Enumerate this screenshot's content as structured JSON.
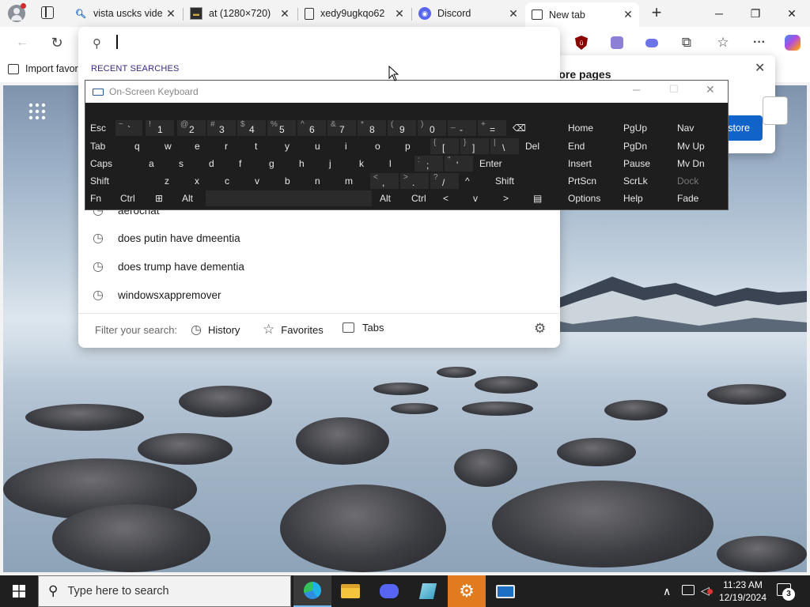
{
  "tabs": [
    {
      "label": "vista uscks vide",
      "icon": "search-favicon"
    },
    {
      "label": "at (1280×720)",
      "icon": "image-favicon"
    },
    {
      "label": "xedy9ugkqo62",
      "icon": "document-favicon"
    },
    {
      "label": "Discord",
      "icon": "discord-favicon"
    },
    {
      "label": "New tab",
      "icon": "newtab-favicon",
      "active": true
    }
  ],
  "toolbar": {
    "address_value": "",
    "extensions": [
      "ublock-icon",
      "extension-icon",
      "discord-extension-icon",
      "puzzle-icon",
      "favorites-icon",
      "more-icon",
      "copilot-icon"
    ]
  },
  "favbar": {
    "import_label": "Import favor"
  },
  "search": {
    "recent_header": "RECENT SEARCHES",
    "items": [
      "aerochat",
      "does putin have dmeentia",
      "does trump have dementia",
      "windowsxappremover"
    ],
    "filter_label": "Filter your search:",
    "filters": [
      "History",
      "Favorites",
      "Tabs"
    ]
  },
  "restore": {
    "title": "Restore pages",
    "button": "store"
  },
  "osk": {
    "title": "On-Screen Keyboard",
    "rows": [
      [
        {
          "m": "Esc"
        },
        {
          "s": "~",
          "m": "`"
        },
        {
          "s": "!",
          "m": "1"
        },
        {
          "s": "@",
          "m": "2"
        },
        {
          "s": "#",
          "m": "3"
        },
        {
          "s": "$",
          "m": "4"
        },
        {
          "s": "%",
          "m": "5"
        },
        {
          "s": "^",
          "m": "6"
        },
        {
          "s": "&",
          "m": "7"
        },
        {
          "s": "*",
          "m": "8"
        },
        {
          "s": "(",
          "m": "9"
        },
        {
          "s": ")",
          "m": "0"
        },
        {
          "s": "_",
          "m": "-"
        },
        {
          "s": "+",
          "m": "="
        },
        {
          "m": "⌫"
        }
      ],
      [
        {
          "m": "Tab"
        },
        {
          "m": "q"
        },
        {
          "m": "w"
        },
        {
          "m": "e"
        },
        {
          "m": "r"
        },
        {
          "m": "t"
        },
        {
          "m": "y"
        },
        {
          "m": "u"
        },
        {
          "m": "i"
        },
        {
          "m": "o"
        },
        {
          "m": "p"
        },
        {
          "s": "{",
          "m": "["
        },
        {
          "s": "}",
          "m": "]"
        },
        {
          "s": "|",
          "m": "\\"
        },
        {
          "m": "Del"
        }
      ],
      [
        {
          "m": "Caps"
        },
        {
          "m": "a"
        },
        {
          "m": "s"
        },
        {
          "m": "d"
        },
        {
          "m": "f"
        },
        {
          "m": "g"
        },
        {
          "m": "h"
        },
        {
          "m": "j"
        },
        {
          "m": "k"
        },
        {
          "m": "l"
        },
        {
          "s": ":",
          "m": ";"
        },
        {
          "s": "\"",
          "m": "'"
        },
        {
          "m": "Enter"
        }
      ],
      [
        {
          "m": "Shift"
        },
        {
          "m": "z"
        },
        {
          "m": "x"
        },
        {
          "m": "c"
        },
        {
          "m": "v"
        },
        {
          "m": "b"
        },
        {
          "m": "n"
        },
        {
          "m": "m"
        },
        {
          "s": "<",
          "m": ","
        },
        {
          "s": ">",
          "m": "."
        },
        {
          "s": "?",
          "m": "/"
        },
        {
          "m": "^"
        },
        {
          "m": "Shift"
        }
      ],
      [
        {
          "m": "Fn"
        },
        {
          "m": "Ctrl"
        },
        {
          "m": "⊞"
        },
        {
          "m": "Alt"
        },
        {
          "m": ""
        },
        {
          "m": "Alt"
        },
        {
          "m": "Ctrl"
        },
        {
          "m": "<"
        },
        {
          "m": "v"
        },
        {
          "m": ">"
        },
        {
          "m": "▤"
        }
      ]
    ],
    "nav": [
      [
        "Home",
        "PgUp",
        "Nav"
      ],
      [
        "End",
        "PgDn",
        "Mv Up"
      ],
      [
        "Insert",
        "Pause",
        "Mv Dn"
      ],
      [
        "PrtScn",
        "ScrLk",
        "Dock"
      ],
      [
        "Options",
        "Help",
        "Fade"
      ]
    ]
  },
  "taskbar": {
    "search_placeholder": "Type here to search",
    "time": "11:23 AM",
    "date": "12/19/2024",
    "notifications": "3",
    "apps": [
      "edge-icon",
      "file-explorer-icon",
      "discord-icon",
      "notepad-icon",
      "settings-icon",
      "remote-desktop-icon"
    ]
  }
}
